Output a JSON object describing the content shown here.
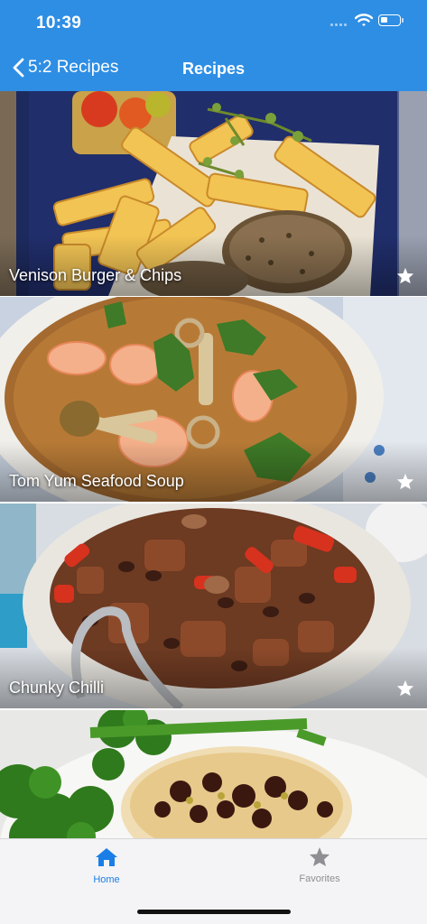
{
  "status_bar": {
    "time": "10:39"
  },
  "nav": {
    "back_label": "5:2 Recipes",
    "title": "Recipes"
  },
  "recipes": [
    {
      "title": "Venison Burger & Chips",
      "favorite_icon": "star-icon"
    },
    {
      "title": "Tom Yum Seafood Soup",
      "favorite_icon": "star-icon"
    },
    {
      "title": "Chunky Chilli",
      "favorite_icon": "star-icon"
    },
    {
      "title": "",
      "favorite_icon": "star-icon"
    }
  ],
  "tabs": [
    {
      "label": "Home",
      "icon": "house-icon",
      "active": true
    },
    {
      "label": "Favorites",
      "icon": "star-icon",
      "active": false
    }
  ],
  "colors": {
    "accent": "#2e8ee4",
    "tab_active": "#1a7ee6",
    "tab_inactive": "#8e8e93"
  }
}
